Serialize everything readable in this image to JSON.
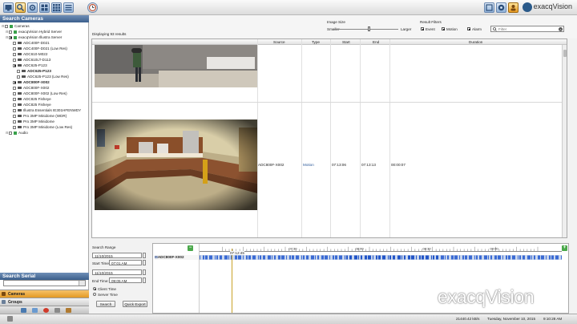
{
  "app": {
    "brand": "exacqVision",
    "watermark": "exacqVision"
  },
  "toolbar": {
    "buttons": [
      "live-view",
      "search",
      "config",
      "tiles-2x2",
      "tiles-3x3",
      "list-view",
      "clock"
    ],
    "right_buttons": [
      "fullscreen",
      "help",
      "account"
    ]
  },
  "left_panel": {
    "title": "Search Cameras",
    "serial_title": "Search Serial",
    "tree": [
      {
        "label": "Cameras",
        "level": 0,
        "checked": false,
        "kind": "root"
      },
      {
        "label": "exacqVision Hybrid Server",
        "level": 1,
        "checked": false,
        "kind": "server"
      },
      {
        "label": "exacqVision Illustra Server",
        "level": 1,
        "checked": true,
        "kind": "server"
      },
      {
        "label": "ADC400F-D021",
        "level": 2,
        "checked": false,
        "kind": "camera"
      },
      {
        "label": "ADC400F-D021 (Low Res)",
        "level": 2,
        "checked": false,
        "kind": "camera"
      },
      {
        "label": "ADC610-M022",
        "level": 2,
        "checked": false,
        "kind": "camera"
      },
      {
        "label": "ADC610LT-D113",
        "level": 2,
        "checked": false,
        "kind": "camera"
      },
      {
        "label": "ADC625-P123",
        "level": 2,
        "checked": true,
        "kind": "camera"
      },
      {
        "label": "ADC625-P123",
        "level": 3,
        "checked": false,
        "kind": "camera",
        "bold": true
      },
      {
        "label": "ADC625-P123 (Low Res)",
        "level": 3,
        "checked": false,
        "kind": "camera"
      },
      {
        "label": "ADC800F-X002",
        "level": 2,
        "checked": true,
        "kind": "camera",
        "bold": true
      },
      {
        "label": "ADC800F-X002",
        "level": 2,
        "checked": false,
        "kind": "camera"
      },
      {
        "label": "ADC800F-X002 (Low Res)",
        "level": 2,
        "checked": false,
        "kind": "camera"
      },
      {
        "label": "ADC825 Fisheye",
        "level": 2,
        "checked": false,
        "kind": "camera"
      },
      {
        "label": "ADC825 Fisheye",
        "level": 2,
        "checked": false,
        "kind": "camera"
      },
      {
        "label": "Illustra Essentials IE301HFENWDY",
        "level": 2,
        "checked": false,
        "kind": "camera"
      },
      {
        "label": "Pro 3MP Minidome (WDR)",
        "level": 2,
        "checked": false,
        "kind": "camera"
      },
      {
        "label": "Pro 3MP Minidome",
        "level": 2,
        "checked": false,
        "kind": "camera"
      },
      {
        "label": "Pro 3MP Minidome (Low Res)",
        "level": 2,
        "checked": false,
        "kind": "camera"
      },
      {
        "label": "Audio",
        "level": 1,
        "checked": false,
        "kind": "server"
      }
    ],
    "nav": {
      "cameras": "Cameras",
      "groups": "Groups"
    }
  },
  "filters": {
    "image_size_label": "Image Size",
    "smaller_label": "Smaller",
    "larger_label": "Larger",
    "image_size_value": 0.55,
    "result_filters_label": "Result Filters",
    "event_label": "Event",
    "motion_label": "Motion",
    "alarm_label": "Alarm",
    "filter_placeholder": "Filter",
    "displaying": "Displaying 93 results"
  },
  "results": {
    "columns": [
      "Source",
      "Type",
      "Start",
      "End",
      "Duration"
    ],
    "rows": [
      {
        "source": "",
        "type": "",
        "start": "",
        "end": "",
        "duration": ""
      },
      {
        "source": "ADC800F-X002",
        "type": "Motion",
        "start": "07:13:06",
        "end": "07:13:13",
        "duration": "00:00:07"
      }
    ]
  },
  "search_range": {
    "title": "Search Range",
    "start_date": "11/10/2015",
    "start_time_label": "Start Time:",
    "start_time": "07:01 AM",
    "end_date": "11/10/2015",
    "end_time_label": "End Time:",
    "end_time": "09:05 AM",
    "client_time": "Client Time",
    "server_time": "Server Time",
    "search_button": "Search",
    "quick_export_button": "Quick Export"
  },
  "timeline": {
    "row_label": "ADC800F-X002",
    "cursor_time": "07:12:45",
    "ticks": [
      "07:30",
      "08:00",
      "08:30",
      "09:00"
    ]
  },
  "status": {
    "bandwidth": "21440.42 kB/s",
    "datetime": "Tuesday, November 10, 2015",
    "time": "9:10:28 AM"
  }
}
